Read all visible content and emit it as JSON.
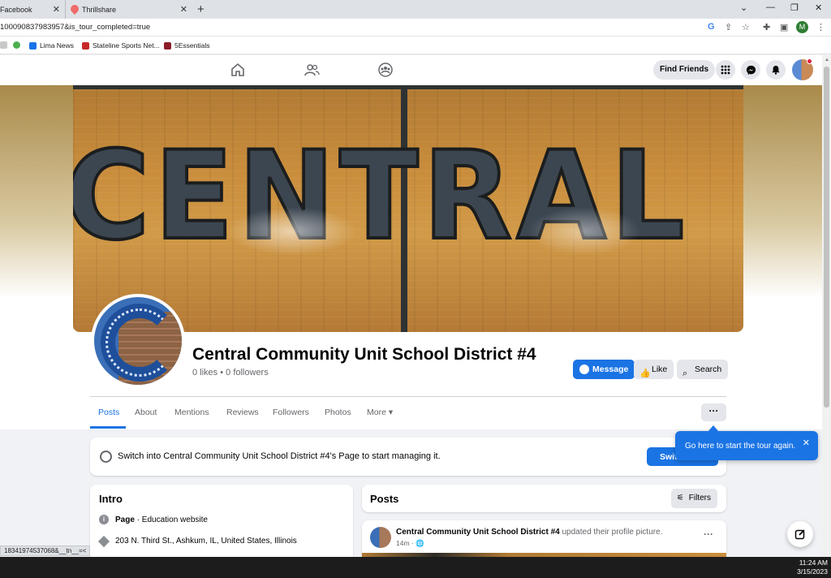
{
  "browser": {
    "tabs": [
      {
        "title": "Facebook",
        "close": "✕"
      },
      {
        "title": "Thrillshare",
        "close": "✕"
      }
    ],
    "new_tab": "+",
    "url": "100090837983957&is_tour_completed=true",
    "bookmarks": [
      "Lima News",
      "Stateline Sports Net...",
      "5Essentials"
    ],
    "profile_initial": "M"
  },
  "fb_nav": {
    "find_friends": "Find Friends"
  },
  "cover": {
    "floor_text": "CENTRAL"
  },
  "page": {
    "name": "Central Community Unit School District #4",
    "stats": "0 likes • 0 followers",
    "message": "Message",
    "like": "Like",
    "search": "Search"
  },
  "tabs": {
    "items": [
      "Posts",
      "About",
      "Mentions",
      "Reviews",
      "Followers",
      "Photos",
      "More ▾"
    ],
    "more_dots": "···"
  },
  "switch_card": {
    "text": "Switch into Central Community Unit School District #4's Page to start managing it.",
    "button": "Swit"
  },
  "tour_tip": {
    "text": "Go here to start the tour again.",
    "close": "✕"
  },
  "intro": {
    "title": "Intro",
    "category_label": "Page",
    "category_value": " · Education website",
    "address": "203 N. Third St., Ashkum, IL, United States, Illinois"
  },
  "posts": {
    "title": "Posts",
    "filters": "Filters",
    "first_post": {
      "author": "Central Community Unit School District #4",
      "action": " updated their profile picture.",
      "time": "14m · 🌐",
      "menu": "···"
    }
  },
  "status_url": "18341974537068&__tn__=<",
  "taskbar": {
    "time": "11:24 AM",
    "date": "3/15/2023"
  },
  "colors": {
    "fb_blue": "#1b74e4",
    "grey_button": "#e4e6eb",
    "background": "#f0f2f5"
  }
}
